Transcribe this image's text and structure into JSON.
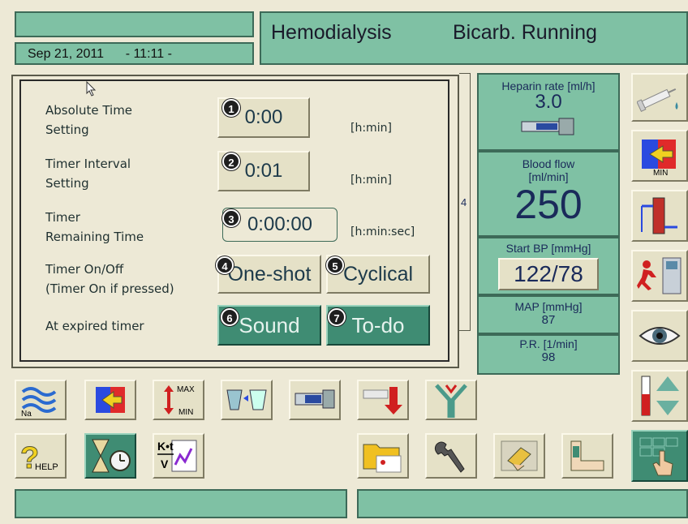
{
  "header": {
    "date": "Sep 21, 2011",
    "time": "- 11:11 -",
    "mode": "Hemodialysis",
    "status": "Bicarb. Running"
  },
  "timer_dialog": {
    "absolute_time_label_1": "Absolute Time",
    "absolute_time_label_2": "Setting",
    "absolute_time_value": "0:00",
    "absolute_time_unit": "[h:min]",
    "interval_label_1": "Timer Interval",
    "interval_label_2": "Setting",
    "interval_value": "0:01",
    "interval_unit": "[h:min]",
    "remaining_label_1": "Timer",
    "remaining_label_2": "Remaining Time",
    "remaining_value": "0:00:00",
    "remaining_unit": "[h:min:sec]",
    "onoff_label_1": "Timer On/Off",
    "onoff_label_2": "(Timer On if pressed)",
    "oneshot_label": "One-shot",
    "cyclical_label": "Cyclical",
    "expired_label": "At expired timer",
    "sound_label": "Sound",
    "todo_label": "To-do",
    "badges": [
      "1",
      "2",
      "3",
      "4",
      "5",
      "6",
      "7"
    ],
    "partial_hidden_text": "4"
  },
  "info": {
    "heparin_label": "Heparin rate  [ml/h]",
    "heparin_value": "3.0",
    "blood_flow_label_1": "Blood flow",
    "blood_flow_label_2": "[ml/min]",
    "blood_flow_value": "250",
    "start_bp_label": "Start BP [mmHg]",
    "start_bp_value": "122/78",
    "map_label": "MAP  [mmHg]",
    "map_value": "87",
    "pr_label": "P.R. [1/min]",
    "pr_value": "98"
  },
  "right_buttons": {
    "min_label": "MIN"
  },
  "bottom_buttons": {
    "na_label": "Na",
    "max_label": "MAX",
    "min_label": "MIN",
    "help_label": "HELP",
    "kt_label_1": "K•t",
    "kt_label_2": "V"
  },
  "colors": {
    "panel_teal": "#7fc1a4",
    "button_dark_teal": "#3f8c73",
    "background": "#ede9d6"
  }
}
